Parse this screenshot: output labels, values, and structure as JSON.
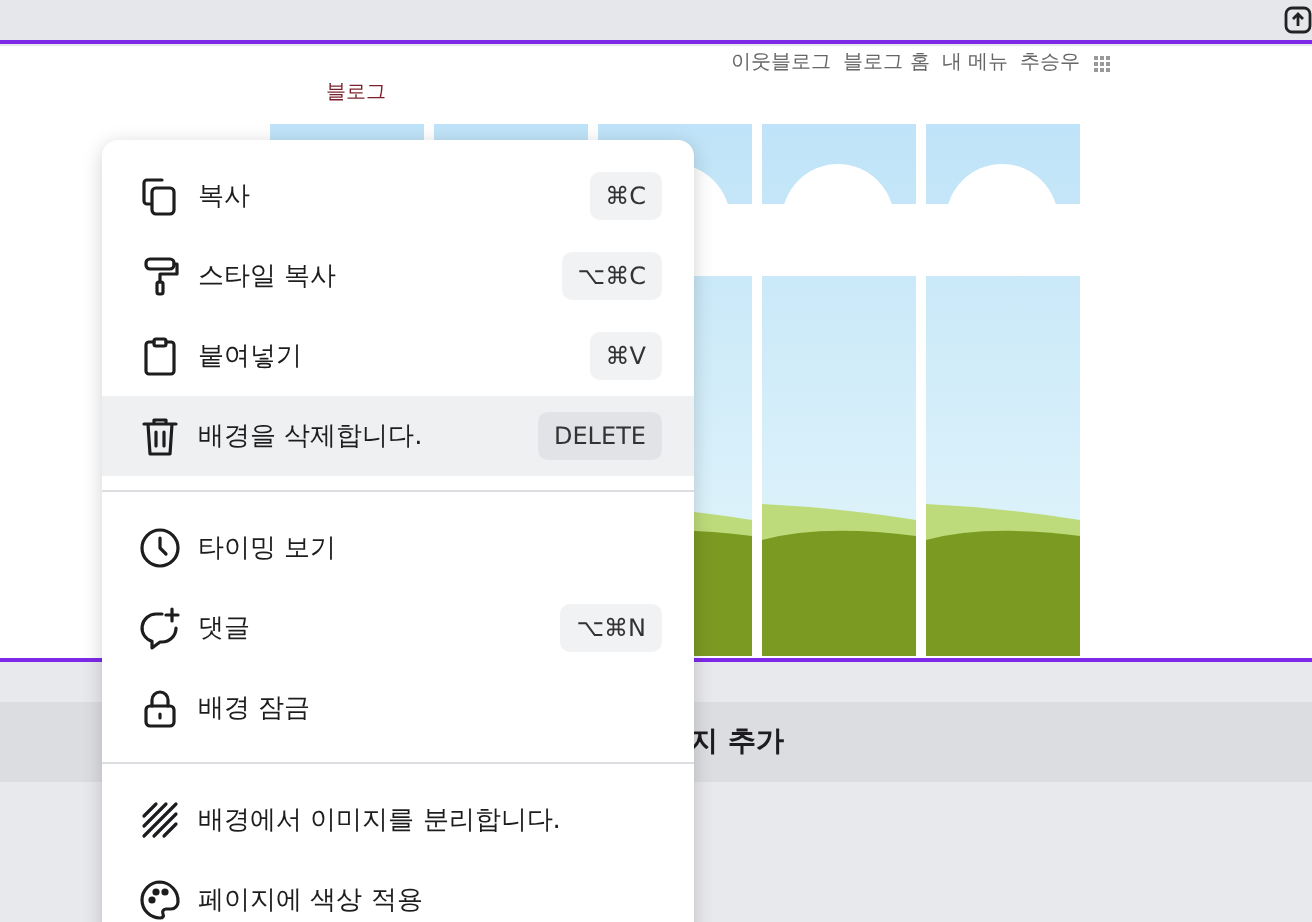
{
  "blog_header": {
    "nav": [
      "이웃블로그",
      "블로그 홈",
      "내 메뉴",
      "추승우"
    ],
    "title": "블로그"
  },
  "add_page_bar": {
    "label": "지 추가"
  },
  "context_menu": {
    "sections": [
      {
        "items": [
          {
            "kind": "copy",
            "label": "복사",
            "shortcut": "⌘C",
            "selected": false
          },
          {
            "kind": "roller",
            "label": "스타일 복사",
            "shortcut": "⌥⌘C",
            "selected": false
          },
          {
            "kind": "clipboard",
            "label": "붙여넣기",
            "shortcut": "⌘V",
            "selected": false
          },
          {
            "kind": "trash",
            "label": "배경을 삭제합니다.",
            "shortcut": "DELETE",
            "selected": true
          }
        ]
      },
      {
        "items": [
          {
            "kind": "clock",
            "label": "타이밍 보기",
            "selected": false
          },
          {
            "kind": "comment",
            "label": "댓글",
            "shortcut": "⌥⌘N",
            "selected": false
          },
          {
            "kind": "lock",
            "label": "배경 잠금",
            "selected": false
          }
        ]
      },
      {
        "items": [
          {
            "kind": "hatch",
            "label": "배경에서 이미지를 분리합니다.",
            "selected": false
          },
          {
            "kind": "palette",
            "label": "페이지에 색상 적용",
            "selected": false
          }
        ]
      }
    ]
  }
}
